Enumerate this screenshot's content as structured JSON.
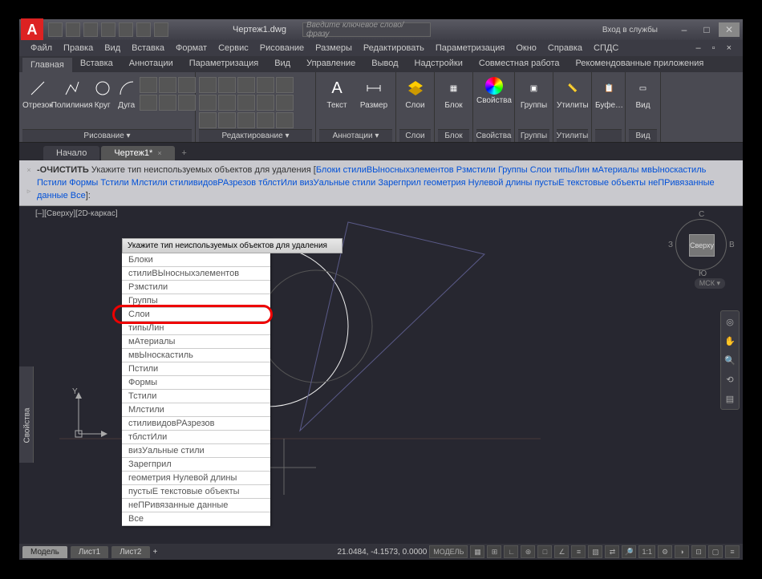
{
  "title": "Чертеж1.dwg",
  "search_placeholder": "Введите ключевое слово/фразу",
  "login": "Вход в службы",
  "menus": [
    "Файл",
    "Правка",
    "Вид",
    "Вставка",
    "Формат",
    "Сервис",
    "Рисование",
    "Размеры",
    "Редактировать",
    "Параметризация",
    "Окно",
    "Справка",
    "СПДС"
  ],
  "ribbon_tabs": [
    "Главная",
    "Вставка",
    "Аннотации",
    "Параметризация",
    "Вид",
    "Управление",
    "Вывод",
    "Надстройки",
    "Совместная работа",
    "Рекомендованные приложения"
  ],
  "panels": {
    "draw": {
      "label": "Рисование ▾",
      "btns": [
        "Отрезок",
        "Полилиния",
        "Круг",
        "Дуга"
      ]
    },
    "edit": {
      "label": "Редактирование ▾"
    },
    "anno": {
      "label": "Аннотации ▾",
      "btns": [
        "Текст",
        "Размер"
      ]
    },
    "layers": {
      "label": "Слои",
      "btn": "Слои"
    },
    "block": {
      "label": "Блок",
      "btn": "Блок"
    },
    "props": {
      "label": "Свойства",
      "btn": "Свойства"
    },
    "groups": {
      "label": "Группы",
      "btn": "Группы"
    },
    "utils": {
      "label": "Утилиты",
      "btn": "Утилиты"
    },
    "clip": {
      "label": "Буфе…"
    },
    "view": {
      "label": "Вид",
      "btn": "Вид"
    }
  },
  "filetabs": [
    "Начало",
    "Чертеж1*"
  ],
  "cmd_prefix": "-ОЧИСТИТЬ",
  "cmd_body1": " Укажите тип неиспользуемых объектов для удаления [",
  "cmd_opts": [
    "Блоки",
    "стилиВЫносныхэлементов",
    "Рзмстили",
    "Группы",
    "Слои",
    "типыЛин",
    "мАтериалы",
    "мвЫноскастиль",
    "Пстили",
    "Формы",
    "Тстили",
    "Млстили",
    "стиливидовРАзрезов",
    "тблстИли",
    "визУальные стили",
    "Зарегприл",
    "геометрия Нулевой длины",
    "пустыЕ текстовые объекты",
    "неПРивязанные данные",
    "Все"
  ],
  "cmd_suffix": "]:",
  "canvas_label": "[–][Сверху][2D-каркас]",
  "viewcube": {
    "top": "Сверху",
    "n": "С",
    "s": "Ю",
    "w": "З",
    "e": "В"
  },
  "mck": "МСК ▾",
  "sidebar_label": "Свойства",
  "dropdown_head": "Укажите тип неиспользуемых объектов для удаления",
  "dropdown_items": [
    "Блоки",
    "стилиВЫносныхэлементов",
    "Рзмстили",
    "Группы",
    "Слои",
    "типыЛин",
    "мАтериалы",
    "мвЫноскастиль",
    "Пстили",
    "Формы",
    "Тстили",
    "Млстили",
    "стиливидовРАзрезов",
    "тблстИли",
    "визУальные стили",
    "Зарегприл",
    "геометрия Нулевой длины",
    "пустыЕ текстовые объекты",
    "неПРивязанные данные",
    "Все"
  ],
  "status": {
    "tabs": [
      "Модель",
      "Лист1",
      "Лист2"
    ],
    "coords": "21.0484, -4.1573, 0.0000",
    "mode": "МОДЕЛЬ",
    "ratio": "1:1"
  }
}
